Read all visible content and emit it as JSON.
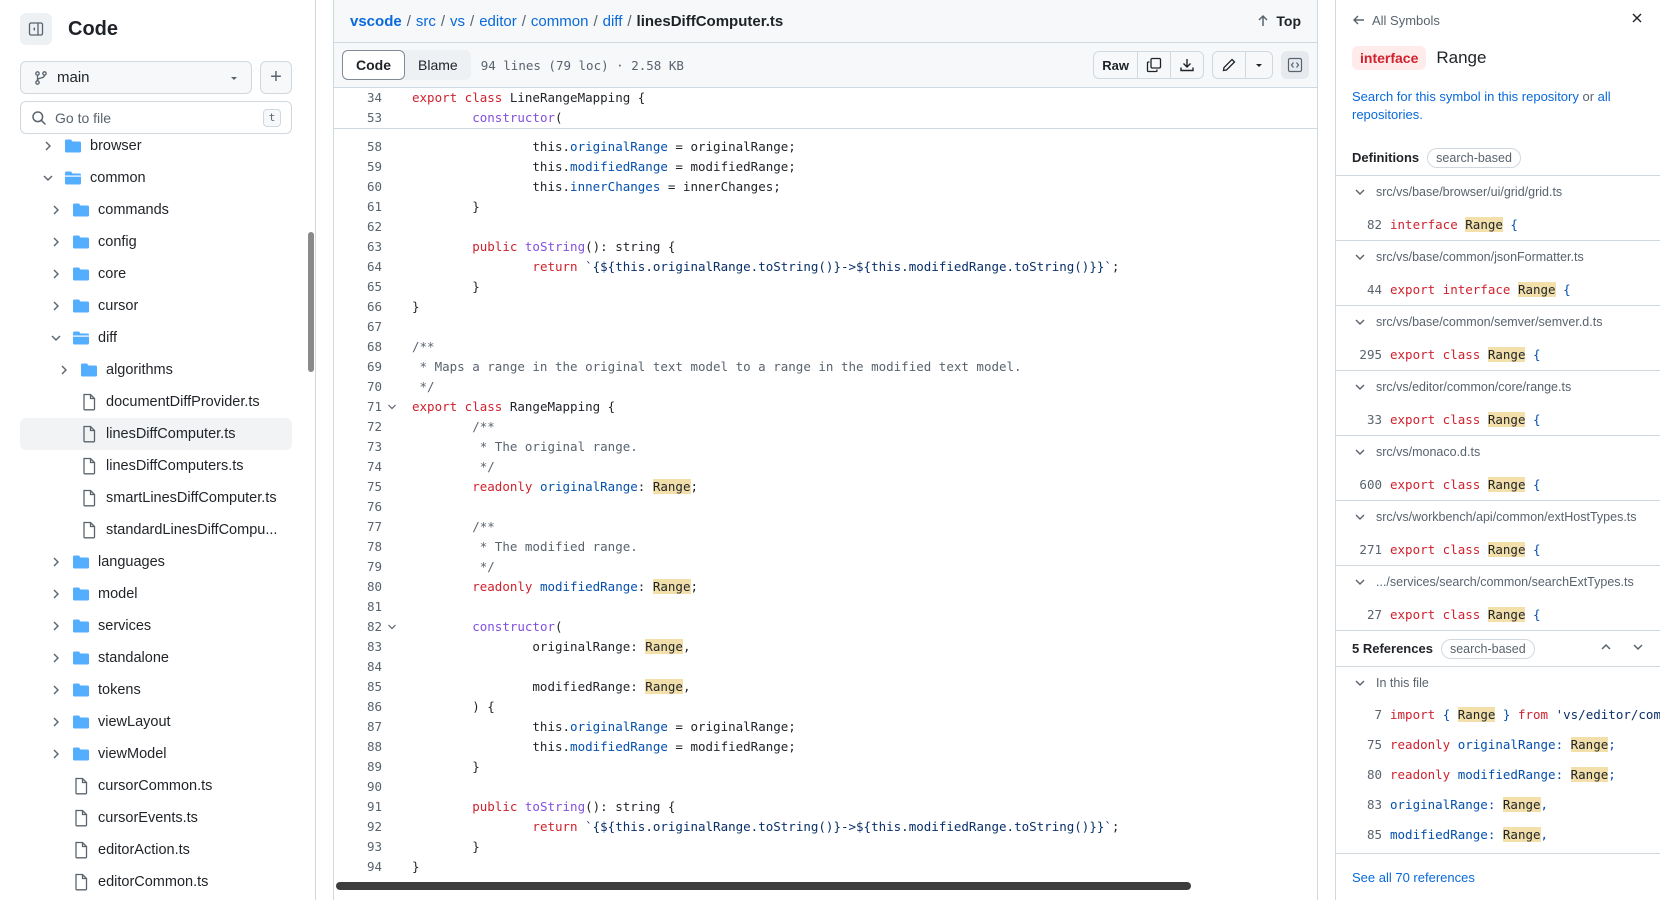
{
  "left": {
    "title": "Code",
    "branch": "main",
    "search_placeholder": "Go to file",
    "search_shortcut": "t",
    "tree": [
      {
        "name": "browser",
        "type": "folder",
        "depth": 1,
        "expanded": false
      },
      {
        "name": "common",
        "type": "folder",
        "depth": 1,
        "expanded": true
      },
      {
        "name": "commands",
        "type": "folder",
        "depth": 2,
        "expanded": false
      },
      {
        "name": "config",
        "type": "folder",
        "depth": 2,
        "expanded": false
      },
      {
        "name": "core",
        "type": "folder",
        "depth": 2,
        "expanded": false
      },
      {
        "name": "cursor",
        "type": "folder",
        "depth": 2,
        "expanded": false
      },
      {
        "name": "diff",
        "type": "folder",
        "depth": 2,
        "expanded": true
      },
      {
        "name": "algorithms",
        "type": "folder",
        "depth": 3,
        "expanded": false
      },
      {
        "name": "documentDiffProvider.ts",
        "type": "file",
        "depth": 3
      },
      {
        "name": "linesDiffComputer.ts",
        "type": "file",
        "depth": 3,
        "selected": true
      },
      {
        "name": "linesDiffComputers.ts",
        "type": "file",
        "depth": 3
      },
      {
        "name": "smartLinesDiffComputer.ts",
        "type": "file",
        "depth": 3
      },
      {
        "name": "standardLinesDiffCompu...",
        "type": "file",
        "depth": 3
      },
      {
        "name": "languages",
        "type": "folder",
        "depth": 2,
        "expanded": false
      },
      {
        "name": "model",
        "type": "folder",
        "depth": 2,
        "expanded": false
      },
      {
        "name": "services",
        "type": "folder",
        "depth": 2,
        "expanded": false
      },
      {
        "name": "standalone",
        "type": "folder",
        "depth": 2,
        "expanded": false
      },
      {
        "name": "tokens",
        "type": "folder",
        "depth": 2,
        "expanded": false
      },
      {
        "name": "viewLayout",
        "type": "folder",
        "depth": 2,
        "expanded": false
      },
      {
        "name": "viewModel",
        "type": "folder",
        "depth": 2,
        "expanded": false
      },
      {
        "name": "cursorCommon.ts",
        "type": "file",
        "depth": 2
      },
      {
        "name": "cursorEvents.ts",
        "type": "file",
        "depth": 2
      },
      {
        "name": "editorAction.ts",
        "type": "file",
        "depth": 2
      },
      {
        "name": "editorCommon.ts",
        "type": "file",
        "depth": 2
      }
    ]
  },
  "code": {
    "breadcrumb": [
      "vscode",
      "src",
      "vs",
      "editor",
      "common",
      "diff"
    ],
    "filename": "linesDiffComputer.ts",
    "top_label": "Top",
    "tabs": {
      "code": "Code",
      "blame": "Blame"
    },
    "file_info": "94 lines (79 loc) · 2.58 KB",
    "raw_label": "Raw",
    "sticky": [
      {
        "n": "34",
        "tokens": [
          [
            "k",
            "export class "
          ],
          [
            "",
            "LineRangeMapping {"
          ]
        ]
      },
      {
        "n": "53",
        "tokens": [
          [
            "",
            "\t"
          ],
          [
            "f",
            "constructor"
          ],
          [
            "",
            "("
          ]
        ]
      }
    ],
    "lines": [
      {
        "n": "58",
        "tokens": [
          [
            "",
            "\t\tthis."
          ],
          [
            "p",
            "originalRange"
          ],
          [
            "",
            " = originalRange;"
          ]
        ]
      },
      {
        "n": "59",
        "tokens": [
          [
            "",
            "\t\tthis."
          ],
          [
            "p",
            "modifiedRange"
          ],
          [
            "",
            " = modifiedRange;"
          ]
        ]
      },
      {
        "n": "60",
        "tokens": [
          [
            "",
            "\t\tthis."
          ],
          [
            "p",
            "innerChanges"
          ],
          [
            "",
            " = innerChanges;"
          ]
        ]
      },
      {
        "n": "61",
        "tokens": [
          [
            "",
            "\t}"
          ]
        ]
      },
      {
        "n": "62",
        "tokens": []
      },
      {
        "n": "63",
        "tokens": [
          [
            "",
            "\t"
          ],
          [
            "k",
            "public "
          ],
          [
            "f",
            "toString"
          ],
          [
            "",
            "(): string {"
          ]
        ]
      },
      {
        "n": "64",
        "tokens": [
          [
            "",
            "\t\t"
          ],
          [
            "k",
            "return "
          ],
          [
            "s",
            "`{${this.originalRange.toString()}->${this.modifiedRange.toString()}}`"
          ],
          [
            "",
            ";"
          ]
        ]
      },
      {
        "n": "65",
        "tokens": [
          [
            "",
            "\t}"
          ]
        ]
      },
      {
        "n": "66",
        "tokens": [
          [
            "",
            "}"
          ]
        ]
      },
      {
        "n": "67",
        "tokens": []
      },
      {
        "n": "68",
        "tokens": [
          [
            "c",
            "/**"
          ]
        ]
      },
      {
        "n": "69",
        "tokens": [
          [
            "c",
            " * Maps a range in the original text model to a range in the modified text model."
          ]
        ]
      },
      {
        "n": "70",
        "tokens": [
          [
            "c",
            " */"
          ]
        ]
      },
      {
        "n": "71",
        "fold": true,
        "tokens": [
          [
            "k",
            "export class "
          ],
          [
            "",
            "RangeMapping {"
          ]
        ]
      },
      {
        "n": "72",
        "tokens": [
          [
            "",
            "\t"
          ],
          [
            "c",
            "/**"
          ]
        ]
      },
      {
        "n": "73",
        "tokens": [
          [
            "",
            "\t"
          ],
          [
            "c",
            " * The original range."
          ]
        ]
      },
      {
        "n": "74",
        "tokens": [
          [
            "",
            "\t"
          ],
          [
            "c",
            " */"
          ]
        ]
      },
      {
        "n": "75",
        "tokens": [
          [
            "",
            "\t"
          ],
          [
            "k",
            "readonly "
          ],
          [
            "p",
            "originalRange"
          ],
          [
            "",
            ": "
          ],
          [
            "hl",
            "Range"
          ],
          [
            "",
            ";"
          ]
        ]
      },
      {
        "n": "76",
        "tokens": []
      },
      {
        "n": "77",
        "tokens": [
          [
            "",
            "\t"
          ],
          [
            "c",
            "/**"
          ]
        ]
      },
      {
        "n": "78",
        "tokens": [
          [
            "",
            "\t"
          ],
          [
            "c",
            " * The modified range."
          ]
        ]
      },
      {
        "n": "79",
        "tokens": [
          [
            "",
            "\t"
          ],
          [
            "c",
            " */"
          ]
        ]
      },
      {
        "n": "80",
        "tokens": [
          [
            "",
            "\t"
          ],
          [
            "k",
            "readonly "
          ],
          [
            "p",
            "modifiedRange"
          ],
          [
            "",
            ": "
          ],
          [
            "hl",
            "Range"
          ],
          [
            "",
            ";"
          ]
        ]
      },
      {
        "n": "81",
        "tokens": []
      },
      {
        "n": "82",
        "fold": true,
        "tokens": [
          [
            "",
            "\t"
          ],
          [
            "f",
            "constructor"
          ],
          [
            "",
            "("
          ]
        ]
      },
      {
        "n": "83",
        "tokens": [
          [
            "",
            "\t\toriginalRange: "
          ],
          [
            "hl",
            "Range"
          ],
          [
            "",
            ","
          ]
        ]
      },
      {
        "n": "84",
        "tokens": []
      },
      {
        "n": "85",
        "tokens": [
          [
            "",
            "\t\tmodifiedRange: "
          ],
          [
            "hl",
            "Range"
          ],
          [
            "",
            ","
          ]
        ]
      },
      {
        "n": "86",
        "tokens": [
          [
            "",
            "\t) {"
          ]
        ]
      },
      {
        "n": "87",
        "tokens": [
          [
            "",
            "\t\tthis."
          ],
          [
            "p",
            "originalRange"
          ],
          [
            "",
            " = originalRange;"
          ]
        ]
      },
      {
        "n": "88",
        "tokens": [
          [
            "",
            "\t\tthis."
          ],
          [
            "p",
            "modifiedRange"
          ],
          [
            "",
            " = modifiedRange;"
          ]
        ]
      },
      {
        "n": "89",
        "tokens": [
          [
            "",
            "\t}"
          ]
        ]
      },
      {
        "n": "90",
        "tokens": []
      },
      {
        "n": "91",
        "tokens": [
          [
            "",
            "\t"
          ],
          [
            "k",
            "public "
          ],
          [
            "f",
            "toString"
          ],
          [
            "",
            "(): string {"
          ]
        ]
      },
      {
        "n": "92",
        "tokens": [
          [
            "",
            "\t\t"
          ],
          [
            "k",
            "return "
          ],
          [
            "s",
            "`{${this.originalRange.toString()}->${this.modifiedRange.toString()}}`"
          ],
          [
            "",
            ";"
          ]
        ]
      },
      {
        "n": "93",
        "tokens": [
          [
            "",
            "\t}"
          ]
        ]
      },
      {
        "n": "94",
        "tokens": [
          [
            "",
            "}"
          ]
        ]
      }
    ]
  },
  "symbols": {
    "back_label": "All Symbols",
    "kind": "interface",
    "name": "Range",
    "search_text_1": "Search for this symbol in this repository",
    "search_text_or": " or ",
    "search_text_2": "all repositories.",
    "definitions_label": "Definitions",
    "definitions_badge": "search-based",
    "definitions": [
      {
        "path": "src/vs/base/browser/ui/grid/grid.ts",
        "line": "82",
        "tokens": [
          [
            "k",
            "interface "
          ],
          [
            "hl",
            "Range"
          ],
          [
            "p",
            " {"
          ]
        ]
      },
      {
        "path": "src/vs/base/common/jsonFormatter.ts",
        "line": "44",
        "tokens": [
          [
            "k",
            "export interface "
          ],
          [
            "hl",
            "Range"
          ],
          [
            "p",
            " {"
          ]
        ]
      },
      {
        "path": "src/vs/base/common/semver/semver.d.ts",
        "line": "295",
        "tokens": [
          [
            "k",
            "export class "
          ],
          [
            "hl",
            "Range"
          ],
          [
            "p",
            " {"
          ]
        ]
      },
      {
        "path": "src/vs/editor/common/core/range.ts",
        "line": "33",
        "tokens": [
          [
            "k",
            "export class "
          ],
          [
            "hl",
            "Range"
          ],
          [
            "p",
            " {"
          ]
        ]
      },
      {
        "path": "src/vs/monaco.d.ts",
        "line": "600",
        "tokens": [
          [
            "k",
            "export class "
          ],
          [
            "hl",
            "Range"
          ],
          [
            "p",
            " {"
          ]
        ]
      },
      {
        "path": "src/vs/workbench/api/common/extHostTypes.ts",
        "line": "271",
        "tokens": [
          [
            "k",
            "export class "
          ],
          [
            "hl",
            "Range"
          ],
          [
            "p",
            " {"
          ]
        ]
      },
      {
        "path": ".../services/search/common/searchExtTypes.ts",
        "line": "27",
        "tokens": [
          [
            "k",
            "export class "
          ],
          [
            "hl",
            "Range"
          ],
          [
            "p",
            " {"
          ]
        ]
      }
    ],
    "references_label": "5 References",
    "references_badge": "search-based",
    "ref_group_label": "In this file",
    "references": [
      {
        "line": "7",
        "tokens": [
          [
            "k",
            "import "
          ],
          [
            "p",
            "{ "
          ],
          [
            "hl",
            "Range"
          ],
          [
            "p",
            " } "
          ],
          [
            "k",
            "from "
          ],
          [
            "s",
            "'vs/editor/comm"
          ]
        ]
      },
      {
        "line": "75",
        "tokens": [
          [
            "k",
            "readonly "
          ],
          [
            "p",
            "originalRange: "
          ],
          [
            "hl",
            "Range"
          ],
          [
            "p",
            ";"
          ]
        ]
      },
      {
        "line": "80",
        "tokens": [
          [
            "k",
            "readonly "
          ],
          [
            "p",
            "modifiedRange: "
          ],
          [
            "hl",
            "Range"
          ],
          [
            "p",
            ";"
          ]
        ]
      },
      {
        "line": "83",
        "tokens": [
          [
            "p",
            "originalRange: "
          ],
          [
            "hl",
            "Range"
          ],
          [
            "p",
            ","
          ]
        ]
      },
      {
        "line": "85",
        "tokens": [
          [
            "p",
            "modifiedRange: "
          ],
          [
            "hl",
            "Range"
          ],
          [
            "p",
            ","
          ]
        ]
      }
    ],
    "see_all": "See all 70 references"
  }
}
